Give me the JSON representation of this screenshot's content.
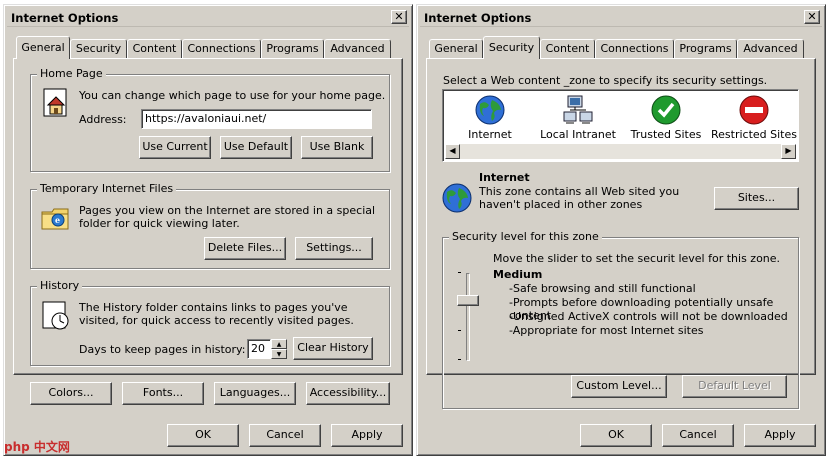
{
  "general": {
    "title": "Internet Options",
    "close_label": "✕",
    "tabs": [
      "General",
      "Security",
      "Content",
      "Connections",
      "Programs",
      "Advanced"
    ],
    "home_page": {
      "label": "Home Page",
      "description": "You can change which page to use for your home page.",
      "address_label": "Address:",
      "address_value": "https://avaloniaui.net/",
      "use_current": "Use Current",
      "use_default": "Use Default",
      "use_blank": "Use Blank"
    },
    "temp_files": {
      "label": "Temporary Internet Files",
      "description": "Pages you view on the Internet are stored in a special folder for quick viewing later.",
      "delete_files": "Delete Files...",
      "settings": "Settings..."
    },
    "history": {
      "label": "History",
      "description": "The History folder contains links to pages you've visited, for quick access to recently visited pages.",
      "days_label": "Days to keep pages in history:",
      "days_value": "20",
      "clear_history": "Clear History"
    },
    "bottom_buttons": {
      "colors": "Colors...",
      "fonts": "Fonts...",
      "languages": "Languages...",
      "accessibility": "Accessibility..."
    },
    "footer": {
      "ok": "OK",
      "cancel": "Cancel",
      "apply": "Apply"
    }
  },
  "security": {
    "title": "Internet Options",
    "close_label": "✕",
    "tabs": [
      "General",
      "Security",
      "Content",
      "Connections",
      "Programs",
      "Advanced"
    ],
    "instruction": "Select a Web content _zone to specify its security settings.",
    "zones": [
      {
        "label": "Internet",
        "icon": "globe-icon"
      },
      {
        "label": "Local Intranet",
        "icon": "network-icon"
      },
      {
        "label": "Trusted Sites",
        "icon": "check-icon"
      },
      {
        "label": "Restricted Sites",
        "icon": "restricted-icon"
      }
    ],
    "selected_zone": {
      "name": "Internet",
      "description": "This zone contains all Web sited you haven't placed in other zones",
      "sites_button": "Sites..."
    },
    "security_level": {
      "label": "Security level for this zone",
      "instruction": "Move the slider to set the securit level for this zone.",
      "level": "Medium",
      "details": [
        "-Safe browsing and still functional",
        "-Prompts before downloading potentially unsafe content",
        "-Unsigned ActiveX controls will not be downloaded",
        "-Appropriate for most Internet sites"
      ],
      "custom_level": "Custom Level...",
      "default_level": "Default Level"
    },
    "footer": {
      "ok": "OK",
      "cancel": "Cancel",
      "apply": "Apply"
    }
  },
  "watermark": "php 中文网"
}
